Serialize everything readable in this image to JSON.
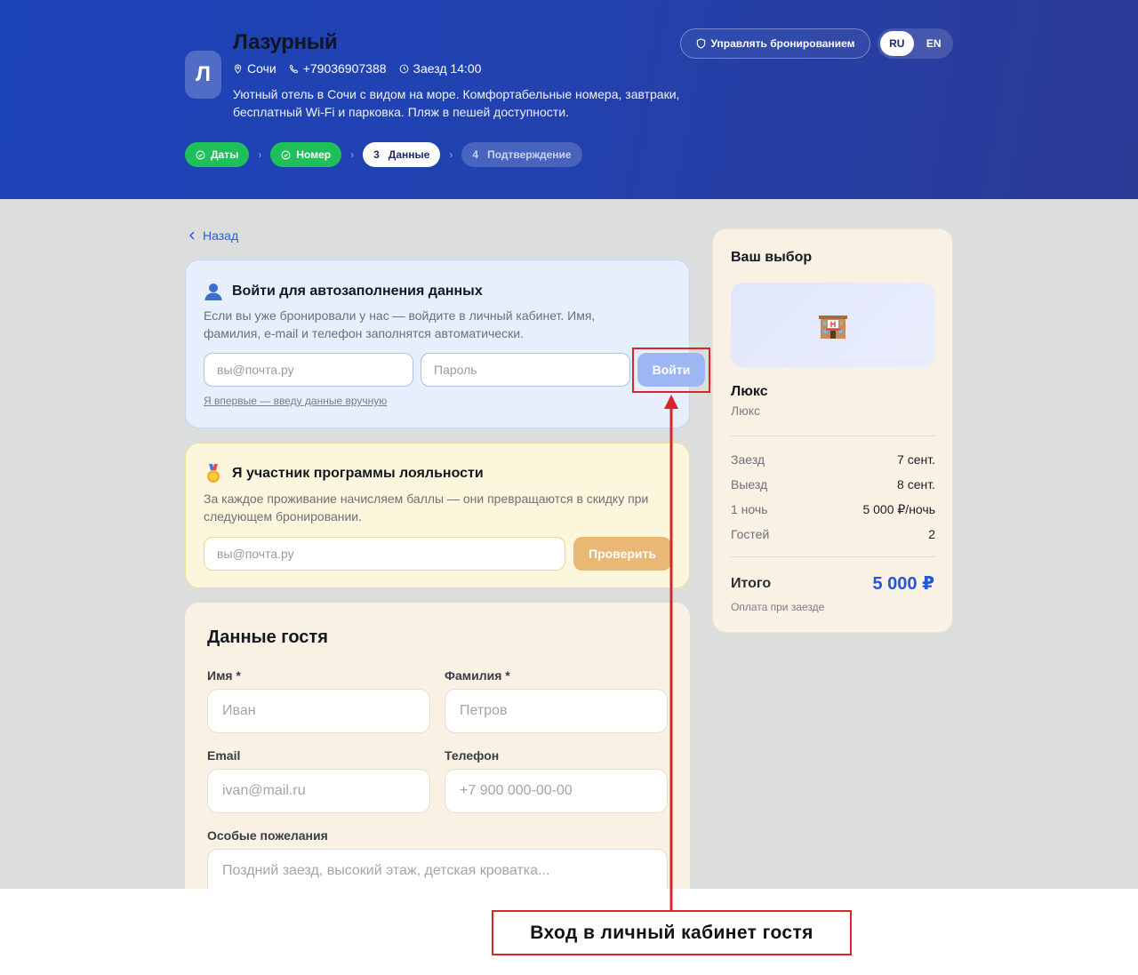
{
  "header": {
    "logo_letter": "Л",
    "hotel_name": "Лазурный",
    "city": "Сочи",
    "phone": "+79036907388",
    "checkin": "Заезд 14:00",
    "description": "Уютный отель в Сочи с видом на море. Комфортабельные номера, завтраки, бесплатный Wi‑Fi и парковка. Пляж в пешей доступности.",
    "manage_label": "Управлять бронированием",
    "lang": {
      "ru": "RU",
      "en": "EN",
      "active": "RU"
    },
    "steps": [
      {
        "label": "Даты",
        "state": "done"
      },
      {
        "label": "Номер",
        "state": "done"
      },
      {
        "num": "3",
        "label": "Данные",
        "state": "active"
      },
      {
        "num": "4",
        "label": "Подтверждение",
        "state": "future"
      }
    ]
  },
  "back_label": "Назад",
  "login": {
    "title": "Войти для автозаполнения данных",
    "text": "Если вы уже бронировали у нас — войдите в личный кабинет. Имя, фамилия, e-mail и телефон заполнятся автоматически.",
    "email_placeholder": "вы@почта.ру",
    "password_placeholder": "Пароль",
    "submit_label": "Войти",
    "manual_link": "Я впервые — введу данные вручную"
  },
  "loyalty": {
    "title": "Я участник программы лояльности",
    "text": "За каждое проживание начисляем баллы — они превращаются в скидку при следующем бронировании.",
    "email_placeholder": "вы@почта.ру",
    "check_label": "Проверить"
  },
  "guest": {
    "title": "Данные гостя",
    "first_name_label": "Имя *",
    "first_name_placeholder": "Иван",
    "last_name_label": "Фамилия *",
    "last_name_placeholder": "Петров",
    "email_label": "Email",
    "email_placeholder": "ivan@mail.ru",
    "phone_label": "Телефон",
    "phone_placeholder": "+7 900 000-00-00",
    "wishes_label": "Особые пожелания",
    "wishes_placeholder": "Поздний заезд, высокий этаж, детская кроватка..."
  },
  "summary": {
    "title": "Ваш выбор",
    "room_name": "Люкс",
    "room_type": "Люкс",
    "rows": [
      {
        "key": "Заезд",
        "value": "7 сент."
      },
      {
        "key": "Выезд",
        "value": "8 сент."
      },
      {
        "key": "1 ночь",
        "value": "5 000 ₽/ночь"
      },
      {
        "key": "Гостей",
        "value": "2"
      }
    ],
    "total_label": "Итого",
    "total_value": "5 000 ₽",
    "pay_note": "Оплата при заезде"
  },
  "annotation": {
    "callout": "Вход в личный кабинет гостя",
    "color": "#d8262b"
  }
}
